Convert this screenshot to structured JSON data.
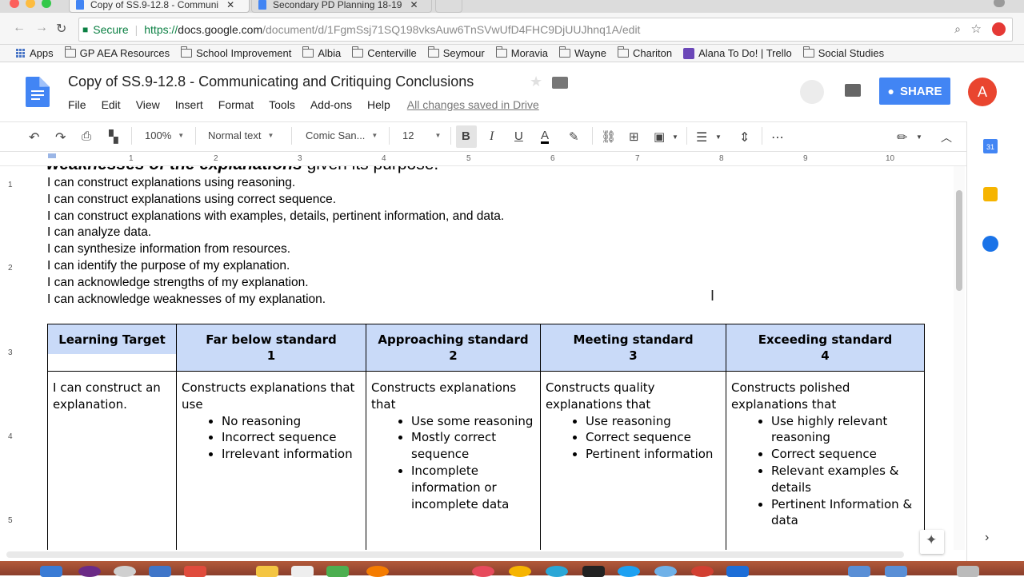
{
  "browser": {
    "tabs": [
      {
        "title": "Copy of SS.9-12.8 - Communi",
        "close": "✕",
        "active": true
      },
      {
        "title": "Secondary PD Planning 18-19",
        "close": "✕",
        "active": false
      }
    ],
    "security_label": "Secure",
    "url_scheme": "https://",
    "url_host": "docs.google.com",
    "url_path": "/document/d/1FgmSsj71SQ198vksAuw6TnSVwUfD4FHC9DjUUJhnq1A/edit",
    "bookmarks": [
      {
        "label": "Apps",
        "icon": "apps-grid-icon"
      },
      {
        "label": "GP AEA Resources",
        "icon": "folder-icon"
      },
      {
        "label": "School Improvement",
        "icon": "folder-icon"
      },
      {
        "label": "Albia",
        "icon": "folder-icon"
      },
      {
        "label": "Centerville",
        "icon": "folder-icon"
      },
      {
        "label": "Seymour",
        "icon": "folder-icon"
      },
      {
        "label": "Moravia",
        "icon": "folder-icon"
      },
      {
        "label": "Wayne",
        "icon": "folder-icon"
      },
      {
        "label": "Chariton",
        "icon": "folder-icon"
      },
      {
        "label": "Alana To Do! | Trello",
        "icon": "trello-icon"
      },
      {
        "label": "Social Studies",
        "icon": "folder-icon"
      }
    ]
  },
  "docs": {
    "title": "Copy of SS.9-12.8 - Communicating and Critiquing Conclusions",
    "menu": [
      "File",
      "Edit",
      "View",
      "Insert",
      "Format",
      "Tools",
      "Add-ons",
      "Help"
    ],
    "saved_status": "All changes saved in Drive",
    "share_label": "SHARE",
    "avatar_letter": "A",
    "toolbar": {
      "zoom": "100%",
      "style": "Normal text",
      "font": "Comic San...",
      "size": "12",
      "bold": "B",
      "italic": "I",
      "underline": "U",
      "text_color": "A"
    },
    "ruler_marks": [
      "1",
      "2",
      "3",
      "4",
      "5",
      "6",
      "7",
      "8",
      "9",
      "10"
    ],
    "vruler_marks": [
      "1",
      "2",
      "3",
      "4",
      "5"
    ],
    "side_calendar": "31"
  },
  "document": {
    "cutoff_line_italic": "weaknesses of the explanations",
    "cutoff_line_normal": " given its purpose.",
    "targets": [
      "I can construct explanations using reasoning.",
      "I can construct explanations using correct sequence.",
      "I can construct explanations with examples, details, pertinent information, and data.",
      "I can analyze data.",
      "I can synthesize information from resources.",
      "I can identify the purpose of my explanation.",
      "I can acknowledge strengths of my explanation.",
      "I can acknowledge weaknesses of my explanation."
    ],
    "rubric": {
      "headers": [
        {
          "label": "Learning Target",
          "score": ""
        },
        {
          "label": "Far below standard",
          "score": "1"
        },
        {
          "label": "Approaching standard",
          "score": "2"
        },
        {
          "label": "Meeting standard",
          "score": "3"
        },
        {
          "label": "Exceeding standard",
          "score": "4"
        }
      ],
      "row": {
        "target": "I can construct an explanation.",
        "far_below": {
          "intro": "Constructs explanations that use",
          "items": [
            "No reasoning",
            "Incorrect sequence",
            "Irrelevant information"
          ]
        },
        "approaching": {
          "intro": "Constructs explanations that",
          "items": [
            "Use some reasoning",
            "Mostly correct sequence",
            "Incomplete information or incomplete data"
          ]
        },
        "meeting": {
          "intro": "Constructs quality explanations that",
          "items": [
            "Use reasoning",
            "Correct sequence",
            "Pertinent information"
          ]
        },
        "exceeding": {
          "intro": "Constructs polished explanations that",
          "items": [
            "Use highly relevant reasoning",
            "Correct sequence",
            "Relevant examples & details",
            "Pertinent Information & data"
          ]
        }
      }
    }
  }
}
